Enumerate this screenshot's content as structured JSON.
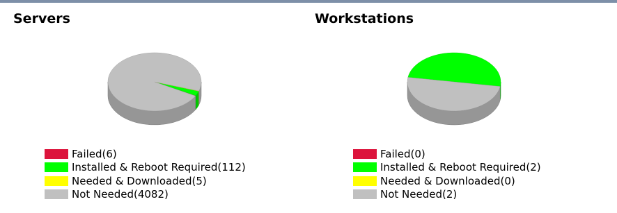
{
  "colors": {
    "failed": "#dc143c",
    "installed_reboot": "#00ff00",
    "needed_downloaded": "#ffff00",
    "not_needed": "#c0c0c0"
  },
  "chart_data": [
    {
      "type": "pie",
      "title": "Servers",
      "categories": [
        "Failed",
        "Installed & Reboot Required",
        "Needed & Downloaded",
        "Not Needed"
      ],
      "values": [
        6,
        112,
        5,
        4082
      ],
      "legend_labels": [
        "Failed(6)",
        "Installed & Reboot Required(112)",
        "Needed & Downloaded(5)",
        "Not Needed(4082)"
      ],
      "colors": [
        "#dc143c",
        "#00ff00",
        "#ffff00",
        "#c0c0c0"
      ],
      "style": "3d",
      "legend_position": "bottom"
    },
    {
      "type": "pie",
      "title": "Workstations",
      "categories": [
        "Failed",
        "Installed & Reboot Required",
        "Needed & Downloaded",
        "Not Needed"
      ],
      "values": [
        0,
        2,
        0,
        2
      ],
      "legend_labels": [
        "Failed(0)",
        "Installed & Reboot Required(2)",
        "Needed & Downloaded(0)",
        "Not Needed(2)"
      ],
      "colors": [
        "#dc143c",
        "#00ff00",
        "#ffff00",
        "#c0c0c0"
      ],
      "style": "3d",
      "legend_position": "bottom"
    }
  ]
}
